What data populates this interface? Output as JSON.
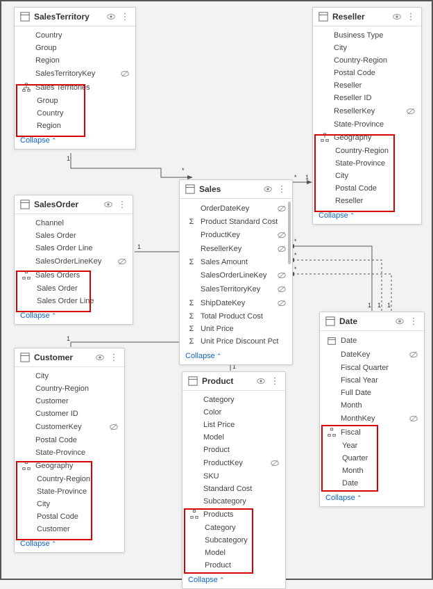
{
  "tables": {
    "salesTerritory": {
      "title": "SalesTerritory",
      "fields": [
        {
          "label": "Country"
        },
        {
          "label": "Group"
        },
        {
          "label": "Region"
        },
        {
          "label": "SalesTerritoryKey",
          "hidden": true
        }
      ],
      "hierarchy": {
        "label": "Sales Territories",
        "children": [
          "Group",
          "Country",
          "Region"
        ]
      },
      "collapse": "Collapse"
    },
    "reseller": {
      "title": "Reseller",
      "fields": [
        {
          "label": "Business Type"
        },
        {
          "label": "City"
        },
        {
          "label": "Country-Region"
        },
        {
          "label": "Postal Code"
        },
        {
          "label": "Reseller"
        },
        {
          "label": "Reseller ID"
        },
        {
          "label": "ResellerKey",
          "hidden": true
        },
        {
          "label": "State-Province"
        }
      ],
      "hierarchy": {
        "label": "Geography",
        "children": [
          "Country-Region",
          "State-Province",
          "City",
          "Postal Code",
          "Reseller"
        ]
      },
      "collapse": "Collapse"
    },
    "salesOrder": {
      "title": "SalesOrder",
      "fields": [
        {
          "label": "Channel"
        },
        {
          "label": "Sales Order"
        },
        {
          "label": "Sales Order Line"
        },
        {
          "label": "SalesOrderLineKey",
          "hidden": true
        }
      ],
      "hierarchy": {
        "label": "Sales Orders",
        "children": [
          "Sales Order",
          "Sales Order Line"
        ]
      },
      "collapse": "Collapse"
    },
    "sales": {
      "title": "Sales",
      "fields": [
        {
          "label": "OrderDateKey",
          "hidden": true
        },
        {
          "label": "Product Standard Cost",
          "agg": true
        },
        {
          "label": "ProductKey",
          "hidden": true
        },
        {
          "label": "ResellerKey",
          "hidden": true
        },
        {
          "label": "Sales Amount",
          "agg": true
        },
        {
          "label": "SalesOrderLineKey",
          "hidden": true
        },
        {
          "label": "SalesTerritoryKey",
          "hidden": true
        },
        {
          "label": "ShipDateKey",
          "hidden": true
        },
        {
          "label": "Total Product Cost",
          "agg": true
        },
        {
          "label": "Unit Price",
          "agg": true
        },
        {
          "label": "Unit Price Discount Pct",
          "agg": true
        }
      ],
      "collapse": "Collapse"
    },
    "customer": {
      "title": "Customer",
      "fields": [
        {
          "label": "City"
        },
        {
          "label": "Country-Region"
        },
        {
          "label": "Customer"
        },
        {
          "label": "Customer ID"
        },
        {
          "label": "CustomerKey",
          "hidden": true
        },
        {
          "label": "Postal Code"
        },
        {
          "label": "State-Province"
        }
      ],
      "hierarchy": {
        "label": "Geography",
        "children": [
          "Country-Region",
          "State-Province",
          "City",
          "Postal Code",
          "Customer"
        ]
      },
      "collapse": "Collapse"
    },
    "product": {
      "title": "Product",
      "fields": [
        {
          "label": "Category"
        },
        {
          "label": "Color"
        },
        {
          "label": "List Price"
        },
        {
          "label": "Model"
        },
        {
          "label": "Product"
        },
        {
          "label": "ProductKey",
          "hidden": true
        },
        {
          "label": "SKU"
        },
        {
          "label": "Standard Cost"
        },
        {
          "label": "Subcategory"
        }
      ],
      "hierarchy": {
        "label": "Products",
        "children": [
          "Category",
          "Subcategory",
          "Model",
          "Product"
        ]
      },
      "collapse": "Collapse"
    },
    "date": {
      "title": "Date",
      "fields": [
        {
          "label": "Date",
          "dateicon": true
        },
        {
          "label": "DateKey",
          "hidden": true
        },
        {
          "label": "Fiscal Quarter"
        },
        {
          "label": "Fiscal Year"
        },
        {
          "label": "Full Date"
        },
        {
          "label": "Month"
        },
        {
          "label": "MonthKey",
          "hidden": true
        }
      ],
      "hierarchy": {
        "label": "Fiscal",
        "children": [
          "Year",
          "Quarter",
          "Month",
          "Date"
        ]
      },
      "collapse": "Collapse"
    }
  },
  "labels": {
    "one": "1",
    "many": "*"
  }
}
